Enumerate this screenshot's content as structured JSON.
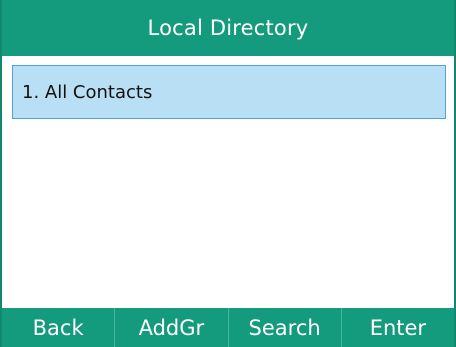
{
  "header": {
    "title": "Local Directory"
  },
  "list": {
    "items": [
      {
        "label": "1. All Contacts",
        "selected": true
      }
    ]
  },
  "softkeys": [
    {
      "label": "Back"
    },
    {
      "label": "AddGr"
    },
    {
      "label": "Search"
    },
    {
      "label": "Enter"
    }
  ],
  "colors": {
    "bar": "#149a7c",
    "highlight": "#b8dff3",
    "highlight_border": "#4da6d8"
  }
}
